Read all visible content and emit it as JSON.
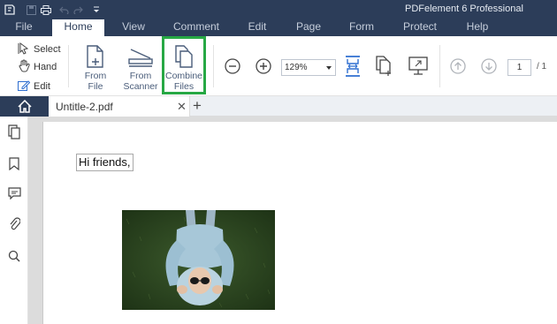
{
  "app": {
    "title": "PDFelement 6 Professional"
  },
  "menu": {
    "tabs": [
      {
        "label": "File"
      },
      {
        "label": "Home"
      },
      {
        "label": "View"
      },
      {
        "label": "Comment"
      },
      {
        "label": "Edit"
      },
      {
        "label": "Page"
      },
      {
        "label": "Form"
      },
      {
        "label": "Protect"
      },
      {
        "label": "Help"
      }
    ],
    "active_tab": "Home"
  },
  "ribbon": {
    "select_label": "Select",
    "hand_label": "Hand",
    "edit_label": "Edit",
    "from_file_label": "From File",
    "from_scanner_line1": "From",
    "from_scanner_line2": "Scanner",
    "combine_line1": "Combine",
    "combine_line2": "Files",
    "zoom_value": "129%",
    "page_current": "1",
    "page_total": "/ 1"
  },
  "tabs": {
    "document_title": "Untitle-2.pdf",
    "close_glyph": "✕",
    "new_tab_glyph": "+"
  },
  "document": {
    "text": "Hi friends,"
  },
  "colors": {
    "titlebar": "#2c3d59",
    "highlight": "#27a844",
    "accent": "#2f6fd0"
  }
}
